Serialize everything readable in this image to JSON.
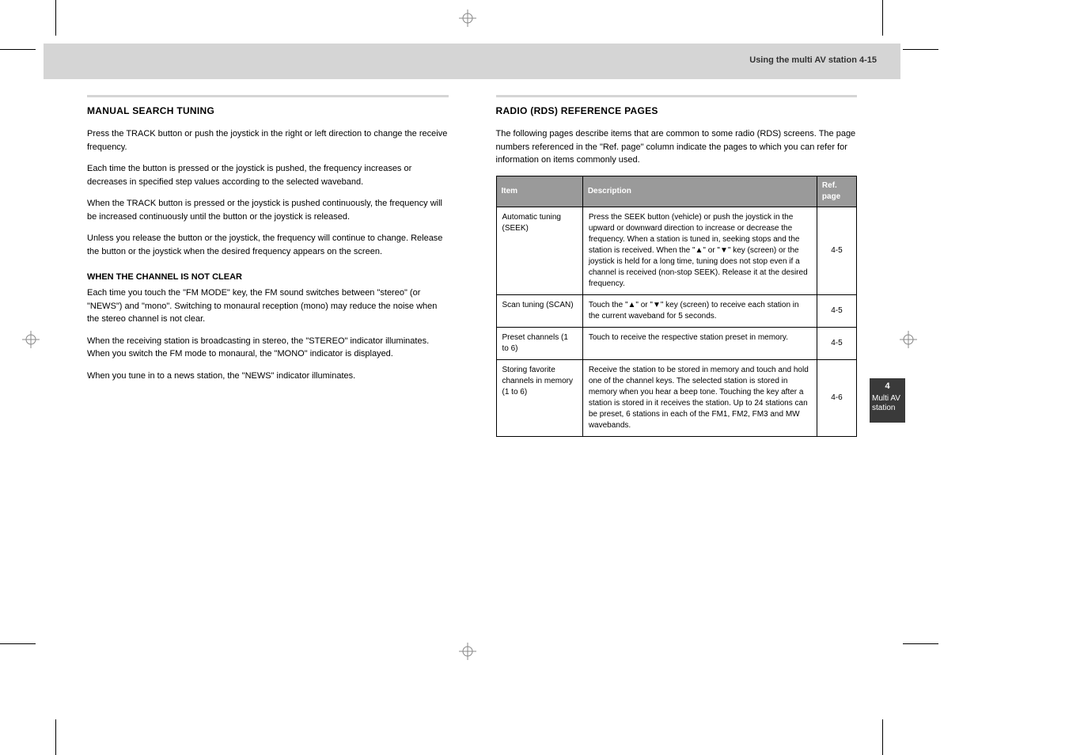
{
  "header": {
    "running": "Using the multi AV station   4-15"
  },
  "left": {
    "title": "MANUAL SEARCH TUNING",
    "p1": "Press the TRACK button or push the joystick in the right or left direction to change the receive frequency.",
    "p2": "Each time the button is pressed or the joystick is pushed, the frequency increases or decreases in specified step values according to the selected waveband.",
    "p3": "When the TRACK button is pressed or the joystick is pushed continuously, the frequency will be increased continuously until the button or the joystick is released.",
    "p4": "Unless you release the button or the joystick, the frequency will continue to change. Release the button or the joystick when the desired frequency appears on the screen.",
    "when": "WHEN THE CHANNEL IS NOT CLEAR",
    "p5": "Each time you touch the \"FM MODE\" key, the FM sound switches between \"stereo\" (or \"NEWS\") and \"mono\". Switching to monaural reception (mono) may reduce the noise when the stereo channel is not clear.",
    "p6": "When the receiving station is broadcasting in stereo, the \"STEREO\" indicator illuminates. When you switch the FM mode to monaural, the \"MONO\" indicator is displayed.",
    "tune": "When you tune in to a news station, the \"NEWS\" indicator illuminates."
  },
  "right": {
    "title": "RADIO (RDS) REFERENCE PAGES",
    "p1": "The following pages describe items that are common to some radio (RDS) screens. The page numbers referenced in the \"Ref. page\" column indicate the pages to which you can refer for information on items commonly used.",
    "table": {
      "head": [
        "Item",
        "Description",
        "Ref. page"
      ],
      "rows": [
        {
          "item": "Automatic tuning (SEEK)",
          "desc": "Press the SEEK button (vehicle) or push the joystick in the upward or downward direction to increase or decrease the frequency. When a station is tuned in, seeking stops and the station is received. When the \"▲\" or \"▼\" key (screen) or the joystick is held for a long time, tuning does not stop even if a channel is received (non-stop SEEK). Release it at the desired frequency.",
          "pg": "4-5"
        },
        {
          "item": "Scan tuning (SCAN)",
          "desc": "Touch the \"▲\" or \"▼\" key (screen) to receive each station in the current waveband for 5 seconds.",
          "pg": "4-5"
        },
        {
          "item": "Preset channels (1 to 6)",
          "desc": "Touch to receive the respective station preset in memory.",
          "pg": "4-5"
        },
        {
          "item": "Storing favorite channels in memory (1 to 6)",
          "desc": "Receive the station to be stored in memory and touch and hold one of the channel keys. The selected station is stored in memory when you hear a beep tone. Touching the key after a station is stored in it receives the station. Up to 24 stations can be preset, 6 stations in each of the FM1, FM2, FM3 and MW wavebands.",
          "pg": "4-6"
        }
      ]
    }
  },
  "tab": {
    "num": "4",
    "label": "Multi AV station"
  }
}
